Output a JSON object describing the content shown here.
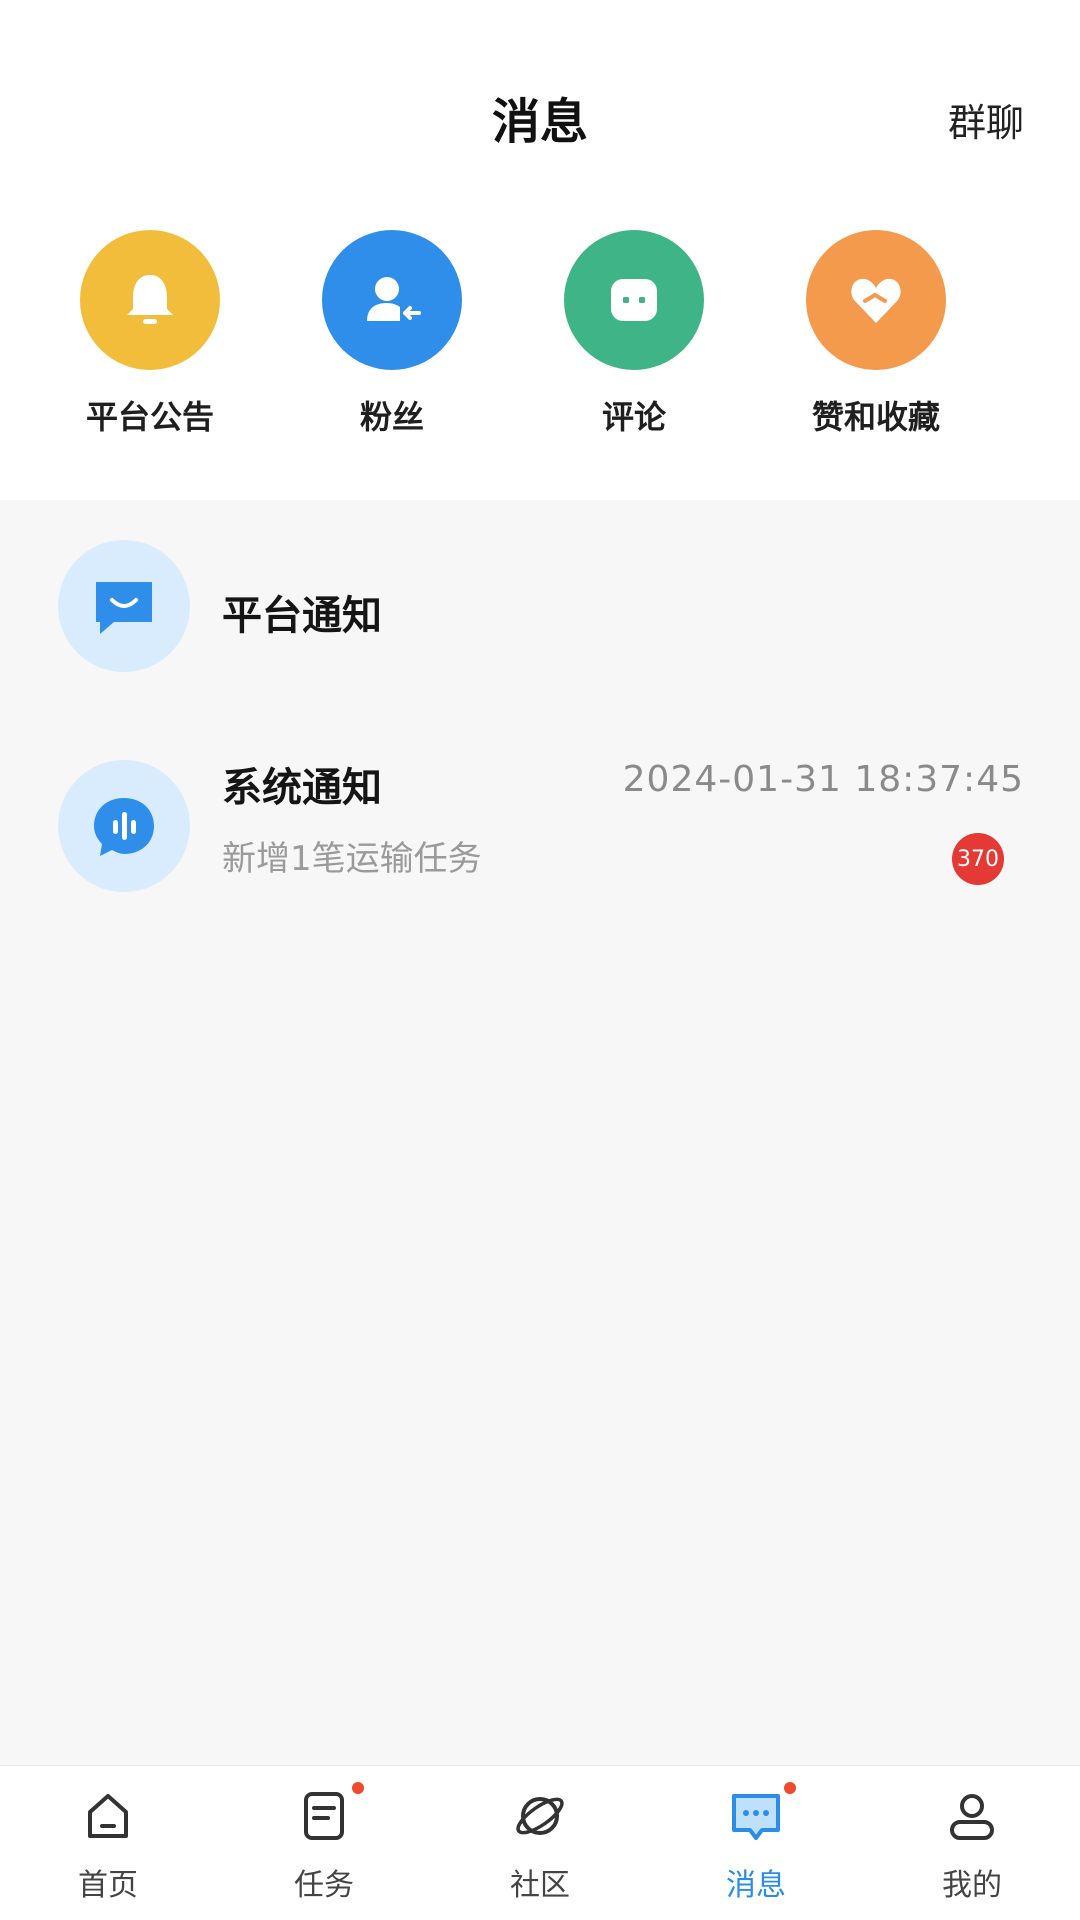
{
  "header": {
    "title": "消息",
    "group_chat_label": "群聊"
  },
  "quick_actions": [
    {
      "label": "平台公告",
      "icon": "bell-icon",
      "color": "#f2bd3a"
    },
    {
      "label": "粉丝",
      "icon": "user-add-icon",
      "color": "#2f8eea"
    },
    {
      "label": "评论",
      "icon": "comment-icon",
      "color": "#3fb486"
    },
    {
      "label": "赞和收藏",
      "icon": "heart-icon",
      "color": "#f39a4c"
    }
  ],
  "messages": [
    {
      "title": "平台通知",
      "icon": "chat-smile-icon"
    },
    {
      "title": "系统通知",
      "icon": "voice-message-icon",
      "time": "2024-01-31 18:37:45",
      "subtitle": "新增1笔运输任务",
      "badge": "370"
    }
  ],
  "bottom_nav": [
    {
      "label": "首页",
      "icon": "home-icon",
      "dot": false
    },
    {
      "label": "任务",
      "icon": "task-icon",
      "dot": true
    },
    {
      "label": "社区",
      "icon": "planet-icon",
      "dot": false
    },
    {
      "label": "消息",
      "icon": "message-icon",
      "dot": true,
      "active": true
    },
    {
      "label": "我的",
      "icon": "profile-icon",
      "dot": false
    }
  ],
  "colors": {
    "accent": "#2b8de8",
    "badge": "#e53935",
    "list_background": "#f7f7f7"
  }
}
